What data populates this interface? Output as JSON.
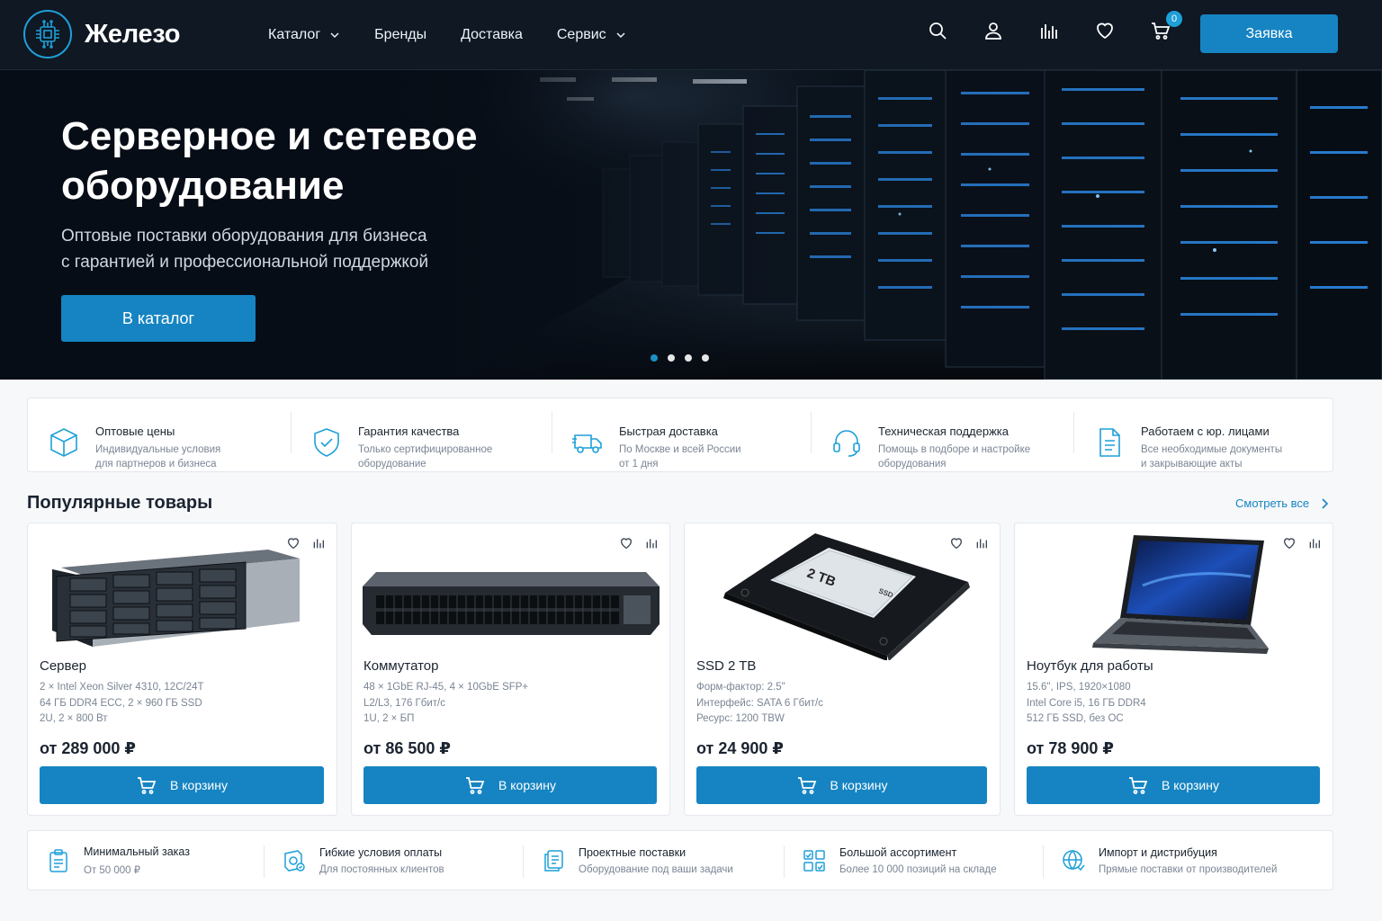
{
  "brand": {
    "name": "Железо"
  },
  "nav": {
    "items": [
      {
        "label": "Каталог",
        "has_dropdown": true
      },
      {
        "label": "Бренды",
        "has_dropdown": false
      },
      {
        "label": "Доставка",
        "has_dropdown": false
      },
      {
        "label": "Сервис",
        "has_dropdown": true
      }
    ]
  },
  "header": {
    "icons": [
      "search-icon",
      "user-icon",
      "compare-icon",
      "heart-icon",
      "cart-icon"
    ],
    "cart_count": "0",
    "order_button": "Заявка"
  },
  "hero": {
    "title": "Серверное и сетевое оборудование",
    "subtitle_line1": "Оптовые поставки оборудования для бизнеса",
    "subtitle_line2": "с гарантией и профессиональной поддержкой",
    "button": "В каталог",
    "slides": 4,
    "active_slide": 1
  },
  "features": [
    {
      "icon": "box-icon",
      "title": "Оптовые цены",
      "desc1": "Индивидуальные условия",
      "desc2": "для партнеров и бизнеса"
    },
    {
      "icon": "shield-check-icon",
      "title": "Гарантия качества",
      "desc1": "Только сертифицированное",
      "desc2": "оборудование"
    },
    {
      "icon": "truck-icon",
      "title": "Быстрая доставка",
      "desc1": "По Москве и всей России",
      "desc2": "от 1 дня"
    },
    {
      "icon": "headset-icon",
      "title": "Техническая поддержка",
      "desc1": "Помощь в подборе и настройке",
      "desc2": "оборудования"
    },
    {
      "icon": "document-icon",
      "title": "Работаем с юр. лицами",
      "desc1": "Все необходимые документы",
      "desc2": "и закрывающие акты"
    }
  ],
  "popular": {
    "title": "Популярные товары",
    "see_all": "Смотреть все",
    "products": [
      {
        "name": "Сервер",
        "spec1": "2 × Intel Xeon Silver 4310, 12C/24T",
        "spec2": "64 ГБ DDR4 ECC, 2 × 960 ГБ SSD",
        "spec3": "2U, 2 × 800 Вт",
        "price": "от 289 000 ₽",
        "button": "В корзину"
      },
      {
        "name": "Коммутатор",
        "spec1": "48 × 1GbE RJ-45, 4 × 10GbE SFP+",
        "spec2": "L2/L3, 176 Гбит/с",
        "spec3": "1U, 2 × БП",
        "price": "от 86 500 ₽",
        "button": "В корзину"
      },
      {
        "name": "SSD 2 TB",
        "spec1": "Форм-фактор: 2.5\"",
        "spec2": "Интерфейс: SATA 6 Гбит/с",
        "spec3": "Ресурс: 1200 TBW",
        "price": "от 24 900 ₽",
        "button": "В корзину",
        "label_text": "2 TB",
        "label_small": "SSD"
      },
      {
        "name": "Ноутбук для работы",
        "spec1": "15.6\", IPS, 1920×1080",
        "spec2": "Intel Core i5, 16 ГБ DDR4",
        "spec3": "512 ГБ SSD, без ОС",
        "price": "от 78 900 ₽",
        "button": "В корзину"
      }
    ]
  },
  "strip": [
    {
      "icon": "clipboard-icon",
      "title": "Минимальный заказ",
      "desc": "От 50 000 ₽"
    },
    {
      "icon": "payment-icon",
      "title": "Гибкие условия оплаты",
      "desc": "Для постоянных клиентов"
    },
    {
      "icon": "docs-icon",
      "title": "Проектные поставки",
      "desc": "Оборудование под ваши задачи"
    },
    {
      "icon": "grid-icon",
      "title": "Большой ассортимент",
      "desc": "Более 10 000 позиций на складе"
    },
    {
      "icon": "globe-icon",
      "title": "Импорт и дистрибуция",
      "desc": "Прямые поставки от производителей"
    }
  ],
  "colors": {
    "accent": "#1684c2",
    "header_bg": "#0f1823",
    "icon_blue": "#1e9fd8"
  }
}
